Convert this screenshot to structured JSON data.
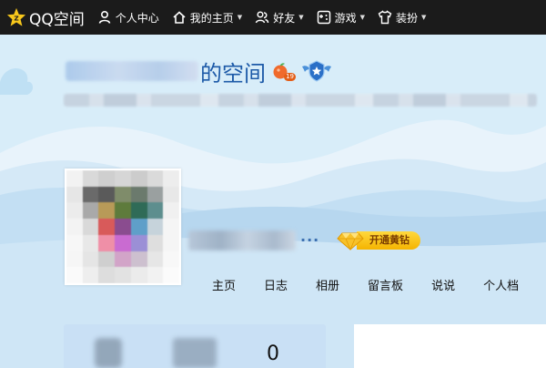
{
  "app": {
    "name": "QQ空间"
  },
  "nav": {
    "items": [
      {
        "id": "profile",
        "label": "个人中心",
        "icon": "person-icon",
        "dropdown": false
      },
      {
        "id": "home",
        "label": "我的主页",
        "icon": "home-icon",
        "dropdown": true
      },
      {
        "id": "friends",
        "label": "好友",
        "icon": "friends-icon",
        "dropdown": true
      },
      {
        "id": "games",
        "label": "游戏",
        "icon": "gamepad-icon",
        "dropdown": true
      },
      {
        "id": "decorate",
        "label": "装扮",
        "icon": "tshirt-icon",
        "dropdown": true
      }
    ]
  },
  "header": {
    "title_suffix": "的空间",
    "level_badge": "19",
    "title_icons": [
      "fruit-badge-icon",
      "winged-badge-icon"
    ]
  },
  "profile": {
    "more_label": "···",
    "vip_button": "开通黄钻"
  },
  "tabs": [
    "主页",
    "日志",
    "相册",
    "留言板",
    "说说",
    "个人档"
  ],
  "stats": {
    "visible_value": "0"
  },
  "colors": {
    "topbar": "#1b1b1b",
    "title_blue": "#1d5aa8",
    "sky": "#cfe6f6",
    "vip_yellow": "#f5b400"
  }
}
